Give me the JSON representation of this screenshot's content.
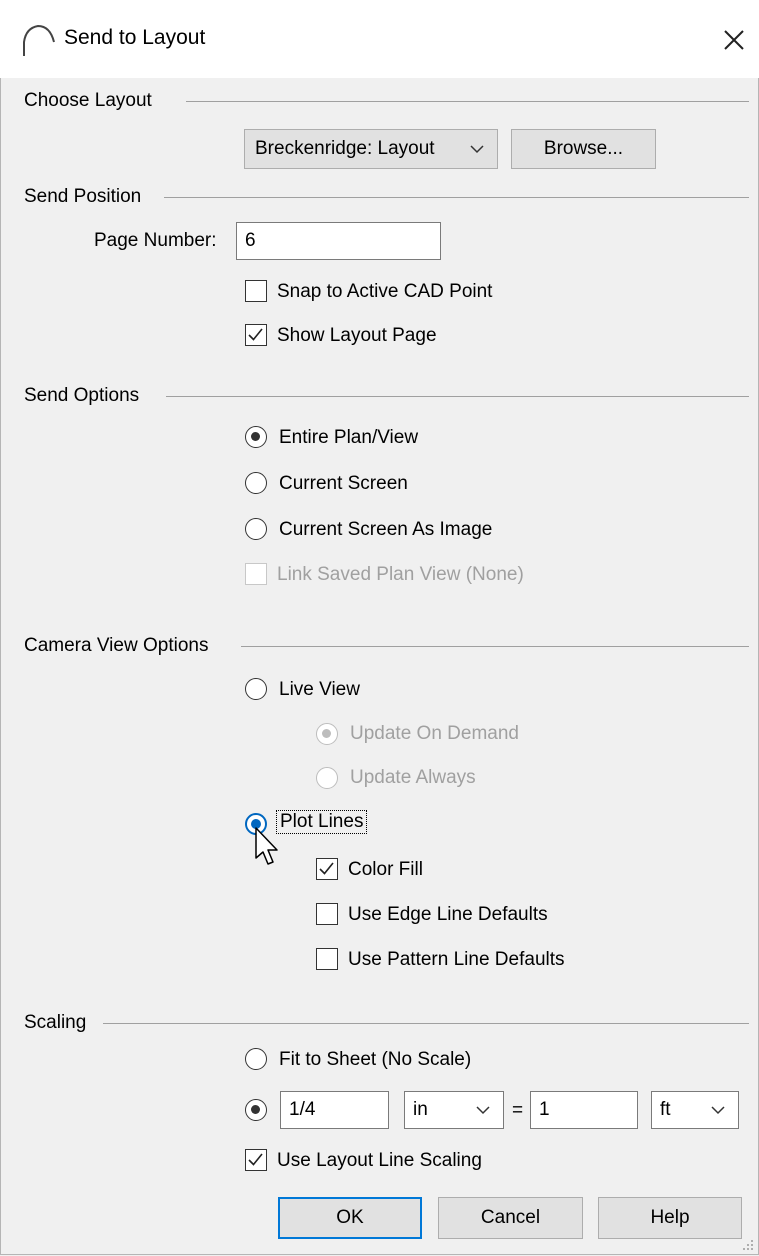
{
  "window": {
    "title": "Send to Layout"
  },
  "choose_layout": {
    "label": "Choose Layout",
    "layout_select": "Breckenridge: Layout",
    "browse_label": "Browse..."
  },
  "send_position": {
    "label": "Send Position",
    "page_number_label": "Page Number:",
    "page_number_value": "6",
    "snap_label": "Snap to Active CAD Point",
    "snap_checked": false,
    "show_layout_label": "Show Layout Page",
    "show_layout_checked": true
  },
  "send_options": {
    "label": "Send Options",
    "entire_plan": "Entire Plan/View",
    "current_screen": "Current Screen",
    "current_screen_image": "Current Screen As Image",
    "link_saved": "Link Saved Plan View (None)",
    "selected": "Entire Plan/View"
  },
  "camera_view": {
    "label": "Camera View Options",
    "live_view": "Live View",
    "update_on_demand": "Update On Demand",
    "update_always": "Update Always",
    "plot_lines": "Plot Lines",
    "color_fill": "Color Fill",
    "color_fill_checked": true,
    "edge_defaults": "Use Edge Line Defaults",
    "pattern_defaults": "Use Pattern Line Defaults",
    "selected": "Plot Lines"
  },
  "scaling": {
    "label": "Scaling",
    "fit_to_sheet": "Fit to Sheet (No Scale)",
    "scale_value": "1/4",
    "scale_unit": "in",
    "equals": "=",
    "real_value": "1",
    "real_unit": "ft",
    "layout_line_scaling": "Use Layout Line Scaling",
    "layout_line_scaling_checked": true
  },
  "buttons": {
    "ok": "OK",
    "cancel": "Cancel",
    "help": "Help"
  }
}
